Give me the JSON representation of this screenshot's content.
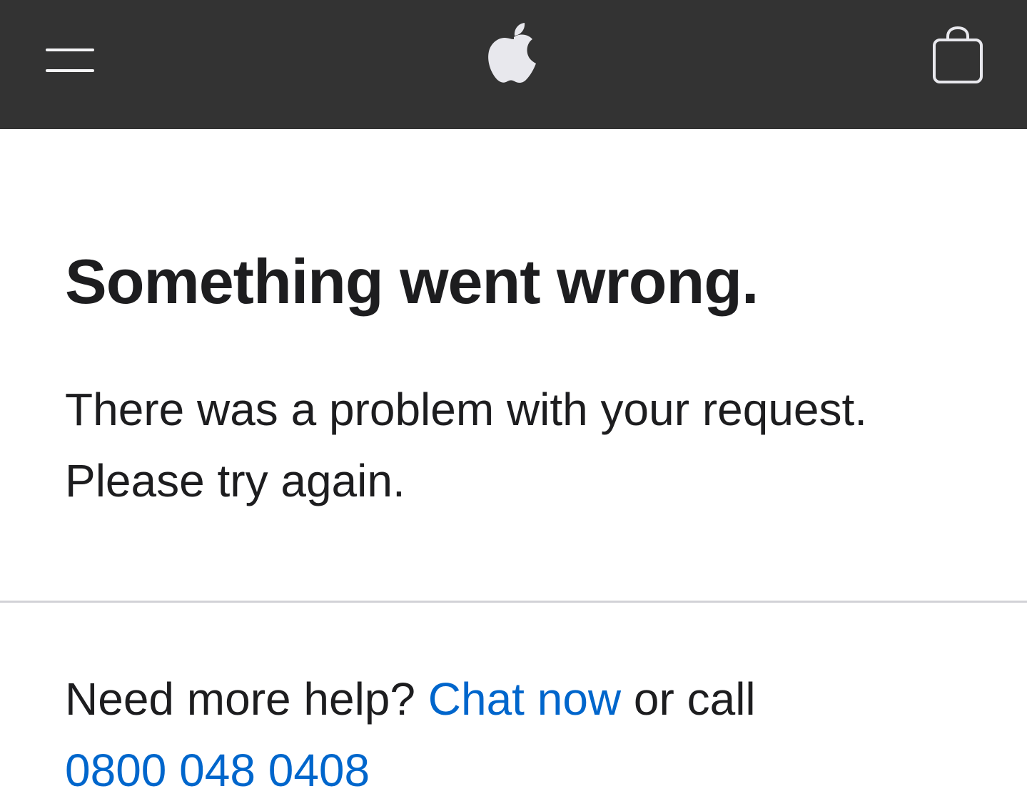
{
  "nav": {
    "menu_icon": "hamburger-icon",
    "logo_icon": "apple-logo-icon",
    "bag_icon": "shopping-bag-icon",
    "background": "#333333",
    "icon_color": "#f5f5f7"
  },
  "main": {
    "headline": "Something went wrong.",
    "message_line1": "There was a problem with your request.",
    "message_line2": "Please try again."
  },
  "help": {
    "prefix": "Need more help? ",
    "chat_link": "Chat now",
    "middle": " or call",
    "phone": "0800 048 0408",
    "link_color": "#0066cc"
  }
}
